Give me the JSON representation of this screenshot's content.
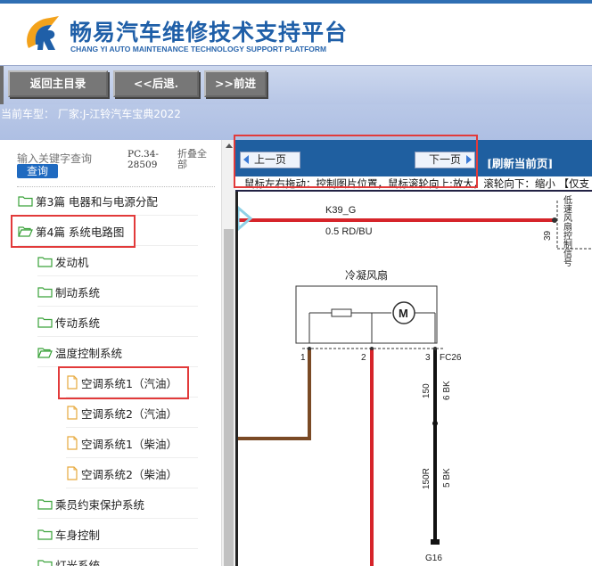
{
  "header": {
    "title_cn": "畅易汽车维修技术支持平台",
    "title_en": "CHANG YI AUTO MAINTENANCE TECHNOLOGY SUPPORT PLATFORM"
  },
  "nav": {
    "home": "返回主目录",
    "back": "<<后退.",
    "forward": ">>前进"
  },
  "current_model": "当前车型： 厂家:J-江铃汽车宝典2022",
  "search": {
    "placeholder": "输入关键字查询",
    "query_button": "查询",
    "pc_code": "PC.34-28509",
    "fold_all": "折叠全部"
  },
  "tree": [
    {
      "label": "第3篇 电器和与电源分配",
      "type": "folder"
    },
    {
      "label": "第4篇 系统电路图",
      "type": "folder-open"
    },
    {
      "label": "发动机",
      "type": "folder"
    },
    {
      "label": "制动系统",
      "type": "folder"
    },
    {
      "label": "传动系统",
      "type": "folder"
    },
    {
      "label": "温度控制系统",
      "type": "folder-open"
    },
    {
      "label": "空调系统1（汽油）",
      "type": "file"
    },
    {
      "label": "空调系统2（汽油）",
      "type": "file"
    },
    {
      "label": "空调系统1（柴油）",
      "type": "file"
    },
    {
      "label": "空调系统2（柴油）",
      "type": "file"
    },
    {
      "label": "乘员约束保护系统",
      "type": "folder"
    },
    {
      "label": "车身控制",
      "type": "folder"
    },
    {
      "label": "灯光系统",
      "type": "folder"
    }
  ],
  "viewer": {
    "prev_page": "上一页",
    "next_page": "下一页",
    "refresh": "[刷新当前页]",
    "hint": "鼠标左右拖动：控制图片位置，鼠标滚轮向上:放大，滚轮向下：缩小 【仅支"
  },
  "diagram": {
    "wire_top_id": "K39_G",
    "wire_top_spec": "0.5 RD/BU",
    "right_pin": "39",
    "right_label": "低速风扇控制信号",
    "component": "冷凝风扇",
    "motor": "M",
    "pin1": "1",
    "pin2": "2",
    "pin3": "3",
    "connector": "FC26",
    "wire_a_id": "150",
    "wire_a_spec": "6 BK",
    "wire_b_id": "150R",
    "wire_b_spec": "5 BK",
    "ground": "G16"
  },
  "colors": {
    "brand_blue": "#1f5fa8",
    "toolbar_blue": "#1f5fa0",
    "highlight_red": "#e23a3a",
    "wire_red": "#d6242a",
    "wire_brown": "#7a4a25"
  }
}
